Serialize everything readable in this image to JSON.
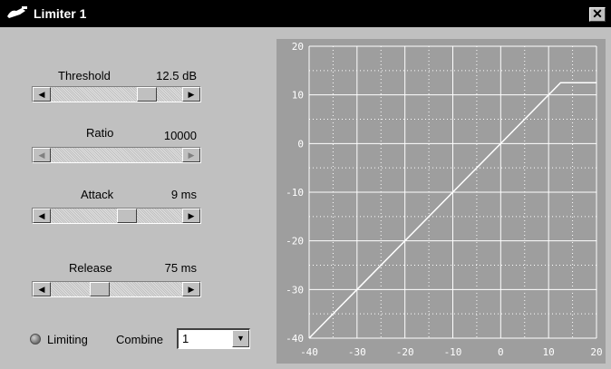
{
  "window": {
    "title": "Limiter 1",
    "close_label": "✕"
  },
  "controls": [
    {
      "label": "Threshold",
      "value": "12.5 dB",
      "slider_fraction": 0.77,
      "disabled": false
    },
    {
      "label": "Ratio",
      "value": "10000",
      "slider_fraction": null,
      "disabled": true
    },
    {
      "label": "Attack",
      "value": "9 ms",
      "slider_fraction": 0.59,
      "disabled": false
    },
    {
      "label": "Release",
      "value": "75 ms",
      "slider_fraction": 0.35,
      "disabled": false
    }
  ],
  "limiting": {
    "label": "Limiting",
    "active": false
  },
  "combine": {
    "label": "Combine",
    "value": "1"
  },
  "chart_data": {
    "type": "line",
    "series": [
      {
        "x": [
          -40,
          12.5,
          20
        ],
        "y": [
          -40,
          12.5,
          12.5
        ]
      }
    ],
    "xlim": [
      -40,
      20
    ],
    "ylim": [
      -40,
      20
    ],
    "xticks": [
      -40,
      -30,
      -20,
      -10,
      0,
      10,
      20
    ],
    "yticks": [
      20,
      10,
      0,
      -10,
      -20,
      -30,
      -40
    ],
    "grid": true,
    "colors": {
      "background": "#9e9e9e",
      "grid": "#ffffff",
      "line": "#ffffff",
      "text": "#ffffff"
    }
  }
}
